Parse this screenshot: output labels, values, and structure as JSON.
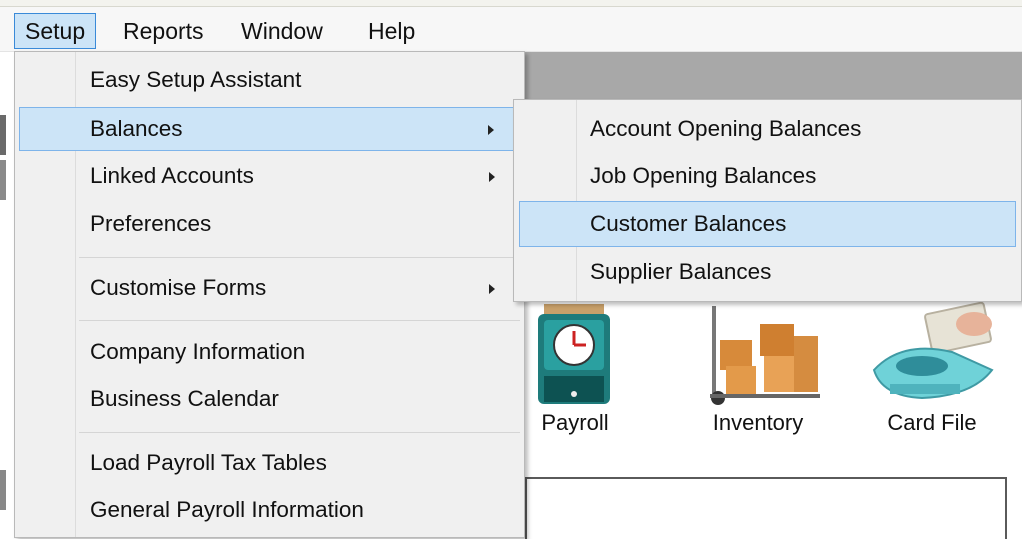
{
  "menubar": {
    "items": [
      {
        "label": "Setup",
        "active": true
      },
      {
        "label": "Reports",
        "active": false
      },
      {
        "label": "Window",
        "active": false
      },
      {
        "label": "Help",
        "active": false
      }
    ]
  },
  "setup_menu": {
    "items": [
      {
        "label": "Easy Setup Assistant",
        "has_submenu": false,
        "highlighted": false
      },
      {
        "label": "Balances",
        "has_submenu": true,
        "highlighted": true
      },
      {
        "label": "Linked Accounts",
        "has_submenu": true,
        "highlighted": false
      },
      {
        "label": "Preferences",
        "has_submenu": false,
        "highlighted": false
      },
      {
        "label": "Customise Forms",
        "has_submenu": true,
        "highlighted": false
      },
      {
        "label": "Company Information",
        "has_submenu": false,
        "highlighted": false
      },
      {
        "label": "Business Calendar",
        "has_submenu": false,
        "highlighted": false
      },
      {
        "label": "Load Payroll Tax Tables",
        "has_submenu": false,
        "highlighted": false
      },
      {
        "label": "General Payroll Information",
        "has_submenu": false,
        "highlighted": false
      }
    ]
  },
  "balances_submenu": {
    "items": [
      {
        "label": "Account Opening Balances",
        "highlighted": false
      },
      {
        "label": "Job Opening Balances",
        "highlighted": false
      },
      {
        "label": "Customer Balances",
        "highlighted": true
      },
      {
        "label": "Supplier Balances",
        "highlighted": false
      }
    ]
  },
  "command_centre": {
    "icons": [
      {
        "label": "Payroll",
        "icon": "time-clock-icon"
      },
      {
        "label": "Inventory",
        "icon": "boxes-trolley-icon"
      },
      {
        "label": "Card File",
        "icon": "card-file-icon"
      }
    ]
  },
  "colors": {
    "highlight": "#cce4f7",
    "highlight_border": "#7eb4ea",
    "menu_bg": "#f0f0f0"
  }
}
